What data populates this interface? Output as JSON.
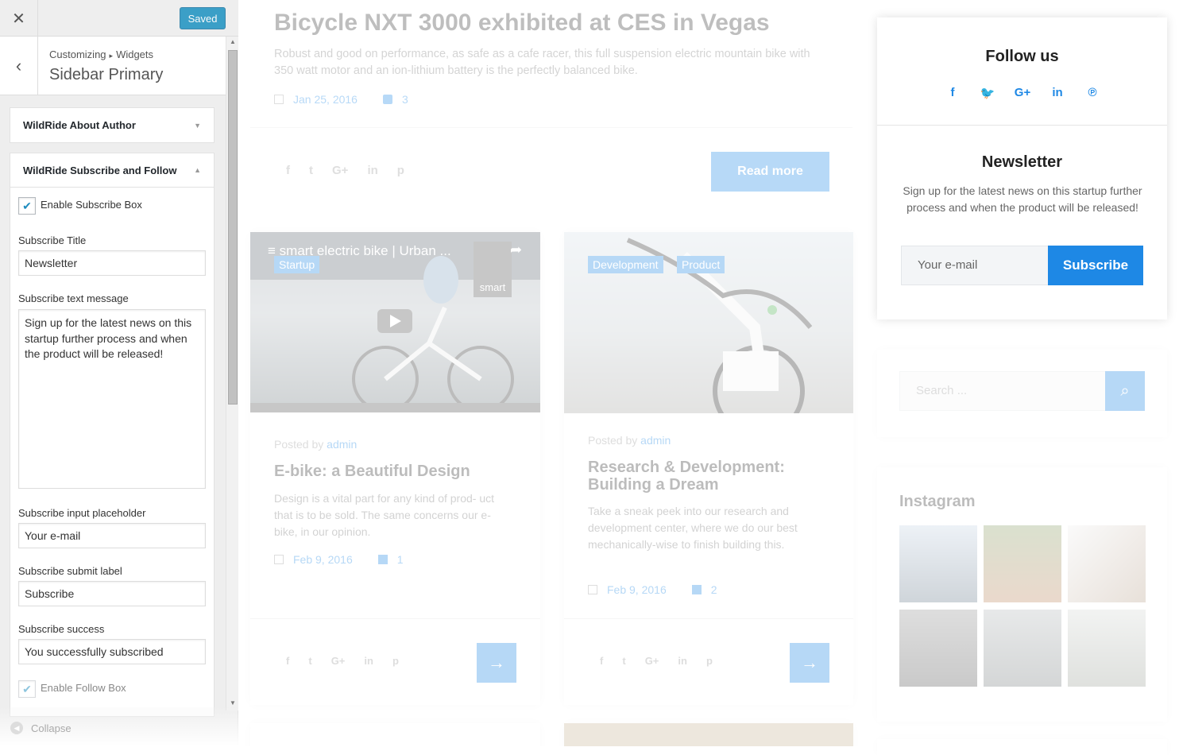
{
  "customizer": {
    "close_label": "✕",
    "saved_label": "Saved",
    "back_label": "‹",
    "breadcrumb_root": "Customizing",
    "breadcrumb_sep": "▸",
    "breadcrumb_leaf": "Widgets",
    "section_title": "Sidebar Primary",
    "collapse_label": "Collapse",
    "widgets": [
      {
        "title": "WildRide About Author",
        "state": "collapsed"
      },
      {
        "title": "WildRide Subscribe and Follow",
        "state": "expanded"
      }
    ],
    "form": {
      "enable_subscribe_label": "Enable Subscribe Box",
      "enable_subscribe_checked": true,
      "subscribe_title_label": "Subscribe Title",
      "subscribe_title_value": "Newsletter",
      "subscribe_text_label": "Subscribe text message",
      "subscribe_text_value": "Sign up for the latest news on this startup further process and when the product will be released!",
      "input_placeholder_label": "Subscribe input placeholder",
      "input_placeholder_value": "Your e-mail",
      "submit_label_label": "Subscribe submit label",
      "submit_label_value": "Subscribe",
      "success_label": "Subscribe success",
      "success_value": "You successfully subscribed",
      "enable_follow_label": "Enable Follow Box",
      "enable_follow_checked": true
    }
  },
  "preview": {
    "featured": {
      "title": "Bicycle NXT 3000 exhibited at CES in Vegas",
      "excerpt": "Robust and good on performance, as safe as a cafe racer, this full suspension electric mountain bike with 350 watt motor and an ion-lithium battery is the perfectly balanced bike.",
      "date": "Jan 25, 2016",
      "comments": "3",
      "read_more": "Read more"
    },
    "posts": [
      {
        "video_title": "smart electric bike | Urban ...",
        "video_brand": "smart",
        "tags": [
          "Startup"
        ],
        "posted_by_prefix": "Posted by",
        "author": "admin",
        "title": "E-bike: a Beautiful Design",
        "excerpt": "Design is a vital part for any kind of prod- uct that is to be sold. The same concerns our e-bike, in our opinion.",
        "date": "Feb 9, 2016",
        "comments": "1"
      },
      {
        "tags": [
          "Development",
          "Product"
        ],
        "posted_by_prefix": "Posted by",
        "author": "admin",
        "title": "Research & Development: Building a Dream",
        "excerpt": "Take a sneak peek into our research and development center, where we do our best mechanically-wise to finish building this.",
        "date": "Feb 9, 2016",
        "comments": "2"
      }
    ],
    "share_icons": [
      "f",
      "t",
      "G+",
      "in",
      "p"
    ],
    "arrow": "→"
  },
  "sidebar": {
    "follow_title": "Follow us",
    "social_icons": [
      "f",
      "🐦",
      "G+",
      "in",
      "℗"
    ],
    "newsletter_title": "Newsletter",
    "newsletter_text": "Sign up for the latest news on this startup further process and when the product will be released!",
    "email_placeholder": "Your e-mail",
    "subscribe_label": "Subscribe",
    "search_placeholder": "Search ...",
    "instagram_title": "Instagram"
  },
  "colors": {
    "accent": "#1e88e5",
    "wp_blue": "#0085ba"
  }
}
